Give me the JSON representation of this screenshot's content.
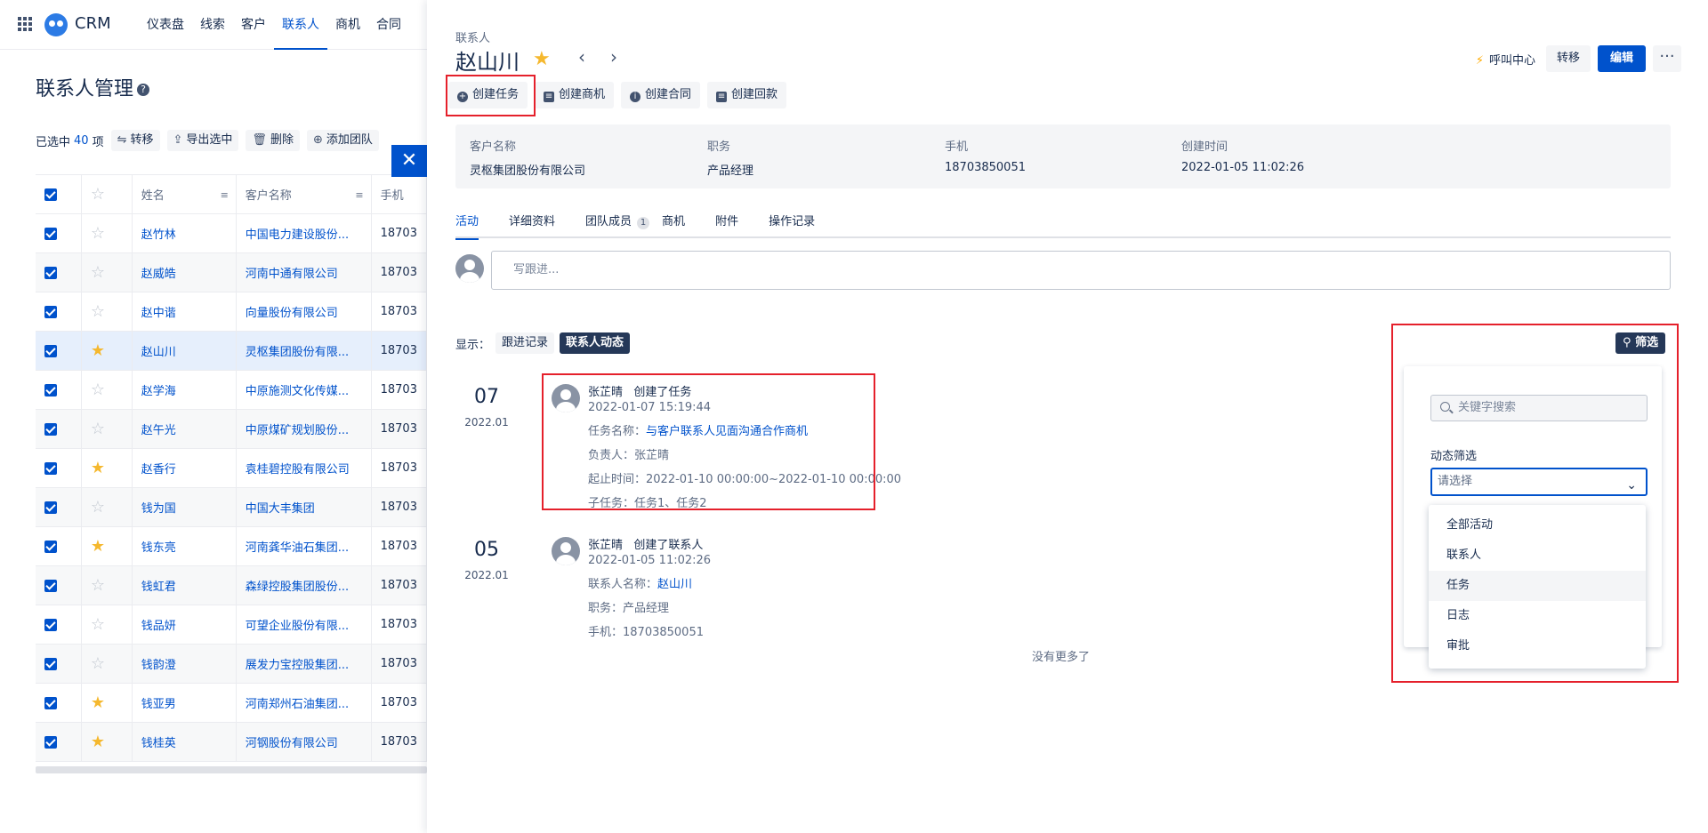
{
  "nav": {
    "brand": "CRM",
    "items": [
      "仪表盘",
      "线索",
      "客户",
      "联系人",
      "商机",
      "合同"
    ],
    "active_index": 3
  },
  "list_page": {
    "title": "联系人管理",
    "selected_prefix": "已选中",
    "selected_count": "40",
    "selected_suffix": "项",
    "bulk_actions": [
      "转移",
      "导出选中",
      "删除",
      "添加团队"
    ],
    "columns": [
      "姓名",
      "客户名称",
      "手机"
    ],
    "rows": [
      {
        "name": "赵竹林",
        "company": "中国电力建设股份...",
        "phone": "18703",
        "starred": false
      },
      {
        "name": "赵威皓",
        "company": "河南中通有限公司",
        "phone": "18703",
        "starred": false
      },
      {
        "name": "赵中谐",
        "company": "向量股份有限公司",
        "phone": "18703",
        "starred": false
      },
      {
        "name": "赵山川",
        "company": "灵枢集团股份有限...",
        "phone": "18703",
        "starred": true,
        "highlight": true
      },
      {
        "name": "赵学海",
        "company": "中原施测文化传媒...",
        "phone": "18703",
        "starred": false
      },
      {
        "name": "赵午光",
        "company": "中原煤矿规划股份...",
        "phone": "18703",
        "starred": false
      },
      {
        "name": "赵香行",
        "company": "袁桂碧控股有限公司",
        "phone": "18703",
        "starred": true
      },
      {
        "name": "钱为国",
        "company": "中国大丰集团",
        "phone": "18703",
        "starred": false
      },
      {
        "name": "钱东亮",
        "company": "河南龚华油石集团...",
        "phone": "18703",
        "starred": true
      },
      {
        "name": "钱虹君",
        "company": "森绿控股集团股份...",
        "phone": "18703",
        "starred": false
      },
      {
        "name": "钱品妍",
        "company": "可望企业股份有限...",
        "phone": "18703",
        "starred": false
      },
      {
        "name": "钱韵澄",
        "company": "展发力宝控股集团...",
        "phone": "18703",
        "starred": false
      },
      {
        "name": "钱亚男",
        "company": "河南郑州石油集团...",
        "phone": "18703",
        "starred": true
      },
      {
        "name": "钱桂英",
        "company": "河钢股份有限公司",
        "phone": "18703",
        "starred": true
      }
    ]
  },
  "drawer": {
    "breadcrumb": "联系人",
    "name": "赵山川",
    "call_center": "呼叫中心",
    "transfer": "转移",
    "edit": "编辑",
    "more": "···",
    "actions": [
      "创建任务",
      "创建商机",
      "创建合同",
      "创建回款"
    ],
    "info": [
      {
        "label": "客户名称",
        "value": "灵枢集团股份有限公司"
      },
      {
        "label": "职务",
        "value": "产品经理"
      },
      {
        "label": "手机",
        "value": "18703850051"
      },
      {
        "label": "创建时间",
        "value": "2022-01-05 11:02:26"
      }
    ],
    "tabs": [
      {
        "label": "活动",
        "badge": ""
      },
      {
        "label": "详细资料",
        "badge": ""
      },
      {
        "label": "团队成员",
        "badge": "1"
      },
      {
        "label": "商机",
        "badge": ""
      },
      {
        "label": "附件",
        "badge": ""
      },
      {
        "label": "操作记录",
        "badge": ""
      }
    ],
    "follow_placeholder": "写跟进...",
    "show_label": "显示：",
    "show_options": [
      "跟进记录",
      "联系人动态"
    ],
    "events": [
      {
        "day": "07",
        "ym": "2022.01",
        "who": "张芷晴",
        "what": "创建了任务",
        "time": "2022-01-07 15:19:44",
        "lines": [
          {
            "k": "任务名称：",
            "v": "与客户联系人见面沟通合作商机",
            "link": true
          },
          {
            "k": "负责人：",
            "v": "张芷晴",
            "link": false
          },
          {
            "k": "起止时间：",
            "v": "2022-01-10 00:00:00~2022-01-10 00:00:00",
            "link": false
          },
          {
            "k": "子任务：",
            "v": "任务1、任务2",
            "link": false
          }
        ]
      },
      {
        "day": "05",
        "ym": "2022.01",
        "who": "张芷晴",
        "what": "创建了联系人",
        "time": "2022-01-05 11:02:26",
        "lines": [
          {
            "k": "联系人名称：",
            "v": "赵山川",
            "link": true
          },
          {
            "k": "职务：",
            "v": "产品经理",
            "link": false
          },
          {
            "k": "手机：",
            "v": "18703850051",
            "link": false
          }
        ]
      }
    ],
    "no_more": "没有更多了",
    "filter": {
      "button": "筛选",
      "search_placeholder": "关键字搜索",
      "label": "动态筛选",
      "select_placeholder": "请选择",
      "options": [
        "全部活动",
        "联系人",
        "任务",
        "日志",
        "审批"
      ],
      "hover_index": 2
    }
  },
  "colors": {
    "primary": "#0052cc",
    "annotation": "#e5202b",
    "star": "#f5b82e"
  }
}
